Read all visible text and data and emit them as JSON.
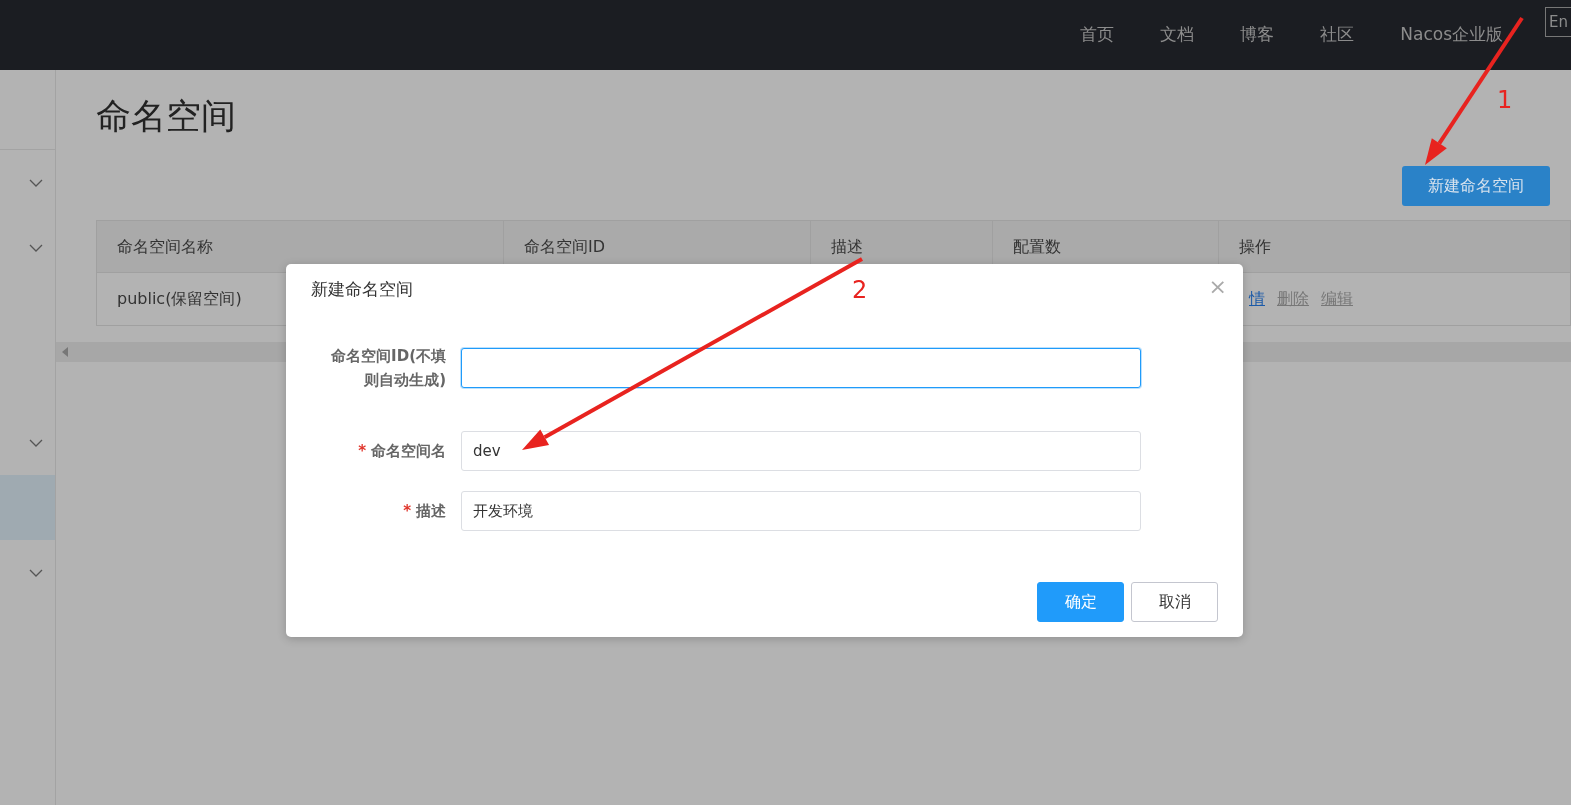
{
  "navbar": {
    "links": [
      "首页",
      "文档",
      "博客",
      "社区",
      "Nacos企业版"
    ],
    "language_button": "En"
  },
  "sidebar": {
    "items": [
      {
        "kind": "blank",
        "selected": false
      },
      {
        "kind": "group",
        "selected": false
      },
      {
        "kind": "group",
        "selected": false
      },
      {
        "kind": "blank",
        "selected": false
      },
      {
        "kind": "group",
        "selected": false
      },
      {
        "kind": "blank",
        "selected": true
      },
      {
        "kind": "group",
        "selected": false
      }
    ]
  },
  "page": {
    "title": "命名空间",
    "new_button": "新建命名空间"
  },
  "table": {
    "columns": [
      "命名空间名称",
      "命名空间ID",
      "描述",
      "配置数",
      "操作"
    ],
    "rows": [
      {
        "cells": [
          "public(保留空间)",
          "",
          "",
          "",
          ""
        ],
        "actions": [
          {
            "label": "情",
            "kind": "link"
          },
          {
            "label": "删除",
            "kind": "muted"
          },
          {
            "label": "编辑",
            "kind": "muted"
          }
        ]
      }
    ]
  },
  "dialog": {
    "title": "新建命名空间",
    "close": "×",
    "fields": [
      {
        "label": "命名空间ID(不填则自动生成)",
        "focused": true
      },
      {
        "label": "命名空间名",
        "required_mark": "*",
        "value": "dev",
        "focused": false
      },
      {
        "label": "描述",
        "required_mark": "*",
        "value": "开发环境",
        "focused": false
      }
    ],
    "buttons": [
      {
        "label": "确定",
        "kind": "primary"
      },
      {
        "label": "取消",
        "kind": "secondary"
      }
    ]
  },
  "annotations": [
    {
      "label": "1"
    },
    {
      "label": "2"
    }
  ]
}
